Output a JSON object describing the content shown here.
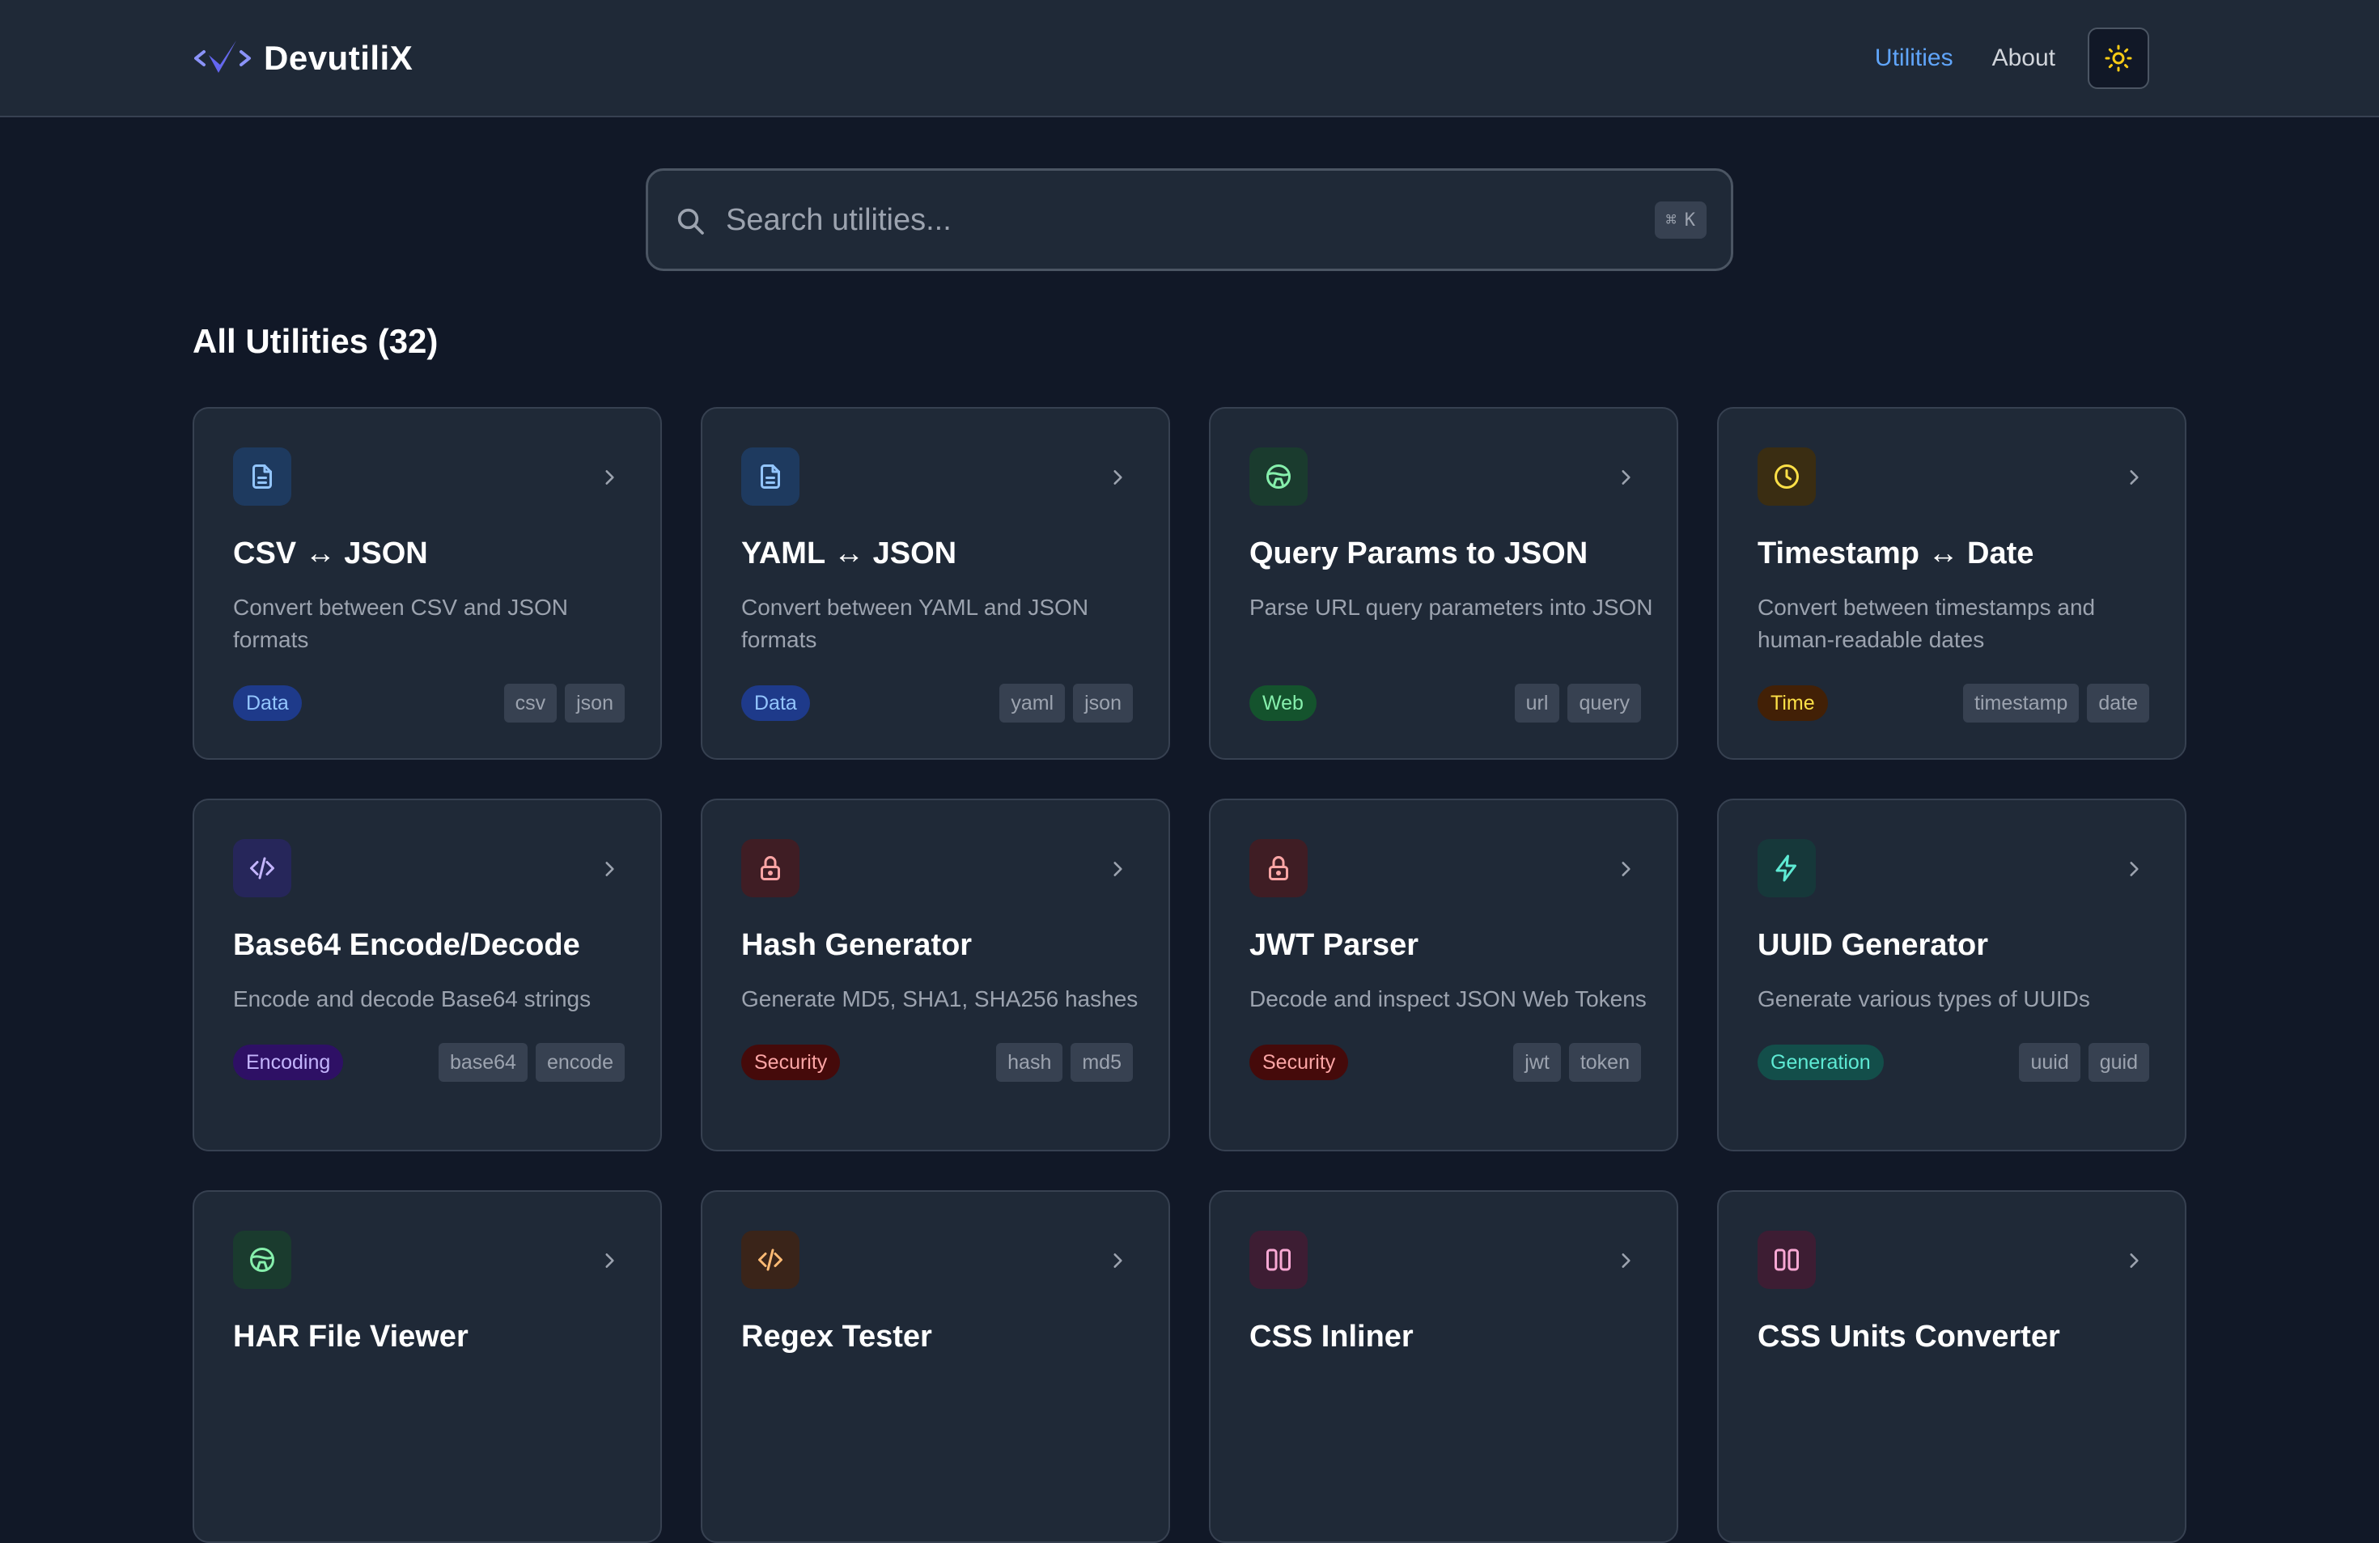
{
  "brand": {
    "name": "DevutiliX"
  },
  "nav": {
    "utilities": "Utilities",
    "about": "About"
  },
  "search": {
    "placeholder": "Search utilities...",
    "kbd_symbol": "⌘",
    "kbd_key": "K"
  },
  "section": {
    "title": "All Utilities (32)"
  },
  "colors": {
    "Data": {
      "fg": "#93c5fd",
      "bg": "#1e3a8a",
      "icbg": "#1e3a5f"
    },
    "Web": {
      "fg": "#86efac",
      "bg": "#14532d",
      "icbg": "#1a3b2e"
    },
    "Time": {
      "fg": "#fde047",
      "bg": "#422006",
      "icbg": "#3a2d12"
    },
    "Encoding": {
      "fg": "#c4b5fd",
      "bg": "#2e1065",
      "icbg": "#26265a"
    },
    "Security": {
      "fg": "#fca5a5",
      "bg": "#450a0a",
      "icbg": "#3f1d24"
    },
    "Generation": {
      "fg": "#5eead4",
      "bg": "#134e4a",
      "icbg": "#16383a"
    },
    "Pink": {
      "fg": "#f9a8d4",
      "bg": "#500724",
      "icbg": "#3d1d33"
    },
    "Orange": {
      "fg": "#fdba74",
      "bg": "#431407",
      "icbg": "#3a2419"
    }
  },
  "cards": [
    {
      "title": "CSV ↔ JSON",
      "desc": "Convert between CSV and JSON formats",
      "category": "Data",
      "tags": [
        "csv",
        "json"
      ],
      "icon": "document-icon",
      "palette": "Data"
    },
    {
      "title": "YAML ↔ JSON",
      "desc": "Convert between YAML and JSON formats",
      "category": "Data",
      "tags": [
        "yaml",
        "json"
      ],
      "icon": "document-icon",
      "palette": "Data"
    },
    {
      "title": "Query Params to JSON",
      "desc": "Parse URL query parameters into JSON",
      "category": "Web",
      "tags": [
        "url",
        "query"
      ],
      "icon": "globe-icon",
      "palette": "Web"
    },
    {
      "title": "Timestamp ↔ Date",
      "desc": "Convert between timestamps and human-readable dates",
      "category": "Time",
      "tags": [
        "timestamp",
        "date"
      ],
      "icon": "clock-icon",
      "palette": "Time"
    },
    {
      "title": "Base64 Encode/Decode",
      "desc": "Encode and decode Base64 strings",
      "category": "Encoding",
      "tags": [
        "base64",
        "encode"
      ],
      "icon": "code-icon",
      "palette": "Encoding"
    },
    {
      "title": "Hash Generator",
      "desc": "Generate MD5, SHA1, SHA256 hashes",
      "category": "Security",
      "tags": [
        "hash",
        "md5"
      ],
      "icon": "lock-icon",
      "palette": "Security"
    },
    {
      "title": "JWT Parser",
      "desc": "Decode and inspect JSON Web Tokens",
      "category": "Security",
      "tags": [
        "jwt",
        "token"
      ],
      "icon": "lock-icon",
      "palette": "Security"
    },
    {
      "title": "UUID Generator",
      "desc": "Generate various types of UUIDs",
      "category": "Generation",
      "tags": [
        "uuid",
        "guid"
      ],
      "icon": "lightning-icon",
      "palette": "Generation"
    },
    {
      "title": "HAR File Viewer",
      "desc": "",
      "category": "",
      "tags": [],
      "icon": "globe-icon",
      "palette": "Web"
    },
    {
      "title": "Regex Tester",
      "desc": "",
      "category": "",
      "tags": [],
      "icon": "code-icon",
      "palette": "Orange"
    },
    {
      "title": "CSS Inliner",
      "desc": "",
      "category": "",
      "tags": [],
      "icon": "columns-icon",
      "palette": "Pink"
    },
    {
      "title": "CSS Units Converter",
      "desc": "",
      "category": "",
      "tags": [],
      "icon": "columns-icon",
      "palette": "Pink"
    }
  ]
}
